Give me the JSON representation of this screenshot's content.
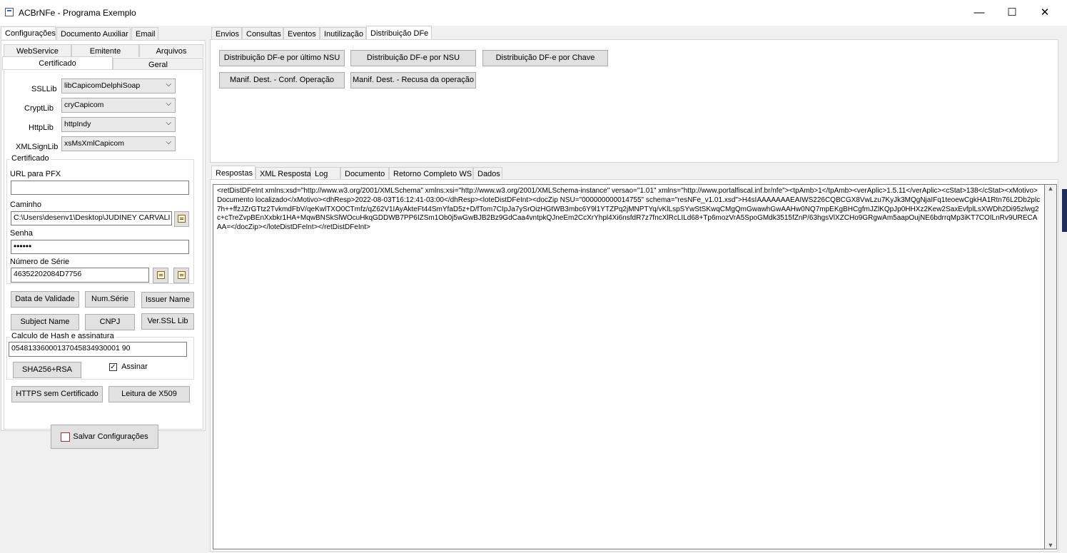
{
  "window": {
    "title": "ACBrNFe - Programa Exemplo",
    "minimize": "—",
    "maximize": "☐",
    "close": "✕"
  },
  "left": {
    "tabs": [
      "Configurações",
      "Documento Auxiliar",
      "Email"
    ],
    "subtabs_row1": [
      "WebService",
      "Emitente",
      "Arquivos"
    ],
    "subtabs_row2": [
      "Certificado",
      "Geral"
    ],
    "ssllib": {
      "label": "SSLLib",
      "value": "libCapicomDelphiSoap"
    },
    "cryptlib": {
      "label": "CryptLib",
      "value": "cryCapicom"
    },
    "httplib": {
      "label": "HttpLib",
      "value": "httpIndy"
    },
    "xmlsignlib": {
      "label": "XMLSignLib",
      "value": "xsMsXmlCapicom"
    },
    "certificado": {
      "group_title": "Certificado",
      "url_pfx_label": "URL para PFX",
      "url_pfx_value": "",
      "caminho_label": "Caminho",
      "caminho_value": "C:\\Users\\desenv1\\Desktop\\JUDINEY CARVALI",
      "senha_label": "Senha",
      "senha_value": "••••••",
      "numero_serie_label": "Número de Série",
      "numero_serie_value": "46352202084D7756"
    },
    "buttons": {
      "data_validade": "Data de Validade",
      "num_serie": "Num.Série",
      "issuer_name": "Issuer Name",
      "subject_name": "Subject Name",
      "cnpj": "CNPJ",
      "ver_ssl_lib": "Ver.SSL Lib"
    },
    "hash": {
      "group_title": "Calculo de Hash e assinatura",
      "value": "05481336000137045834930001 90",
      "sha_button": "SHA256+RSA",
      "assinar_label": "Assinar",
      "assinar_checked": "✓"
    },
    "https_button": "HTTPS sem Certificado",
    "x509_button": "Leitura de X509",
    "salvar_button": "Salvar Configurações"
  },
  "right": {
    "tabs": [
      "Envios",
      "Consultas",
      "Eventos",
      "Inutilização",
      "Distribuição DFe"
    ],
    "buttons": {
      "dist_ultimo_nsu": "Distribuição DF-e por último NSU",
      "dist_nsu": "Distribuição DF-e por NSU",
      "dist_chave": "Distribuição DF-e por Chave",
      "manif_conf": "Manif. Dest. - Conf. Operação",
      "manif_recusa": "Manif. Dest. - Recusa da operação"
    },
    "resp_tabs": [
      "Respostas",
      "XML Resposta",
      "Log",
      "Documento",
      "Retorno Completo WS",
      "Dados"
    ],
    "response_text": "<retDistDFeInt xmlns:xsd=\"http://www.w3.org/2001/XMLSchema\" xmlns:xsi=\"http://www.w3.org/2001/XMLSchema-instance\" versao=\"1.01\" xmlns=\"http://www.portalfiscal.inf.br/nfe\"><tpAmb>1</tpAmb><verAplic>1.5.11</verAplic><cStat>138</cStat><xMotivo>Documento localizado</xMotivo><dhResp>2022-08-03T16:12:41-03:00</dhResp><loteDistDFeInt><docZip NSU=\"000000000014755\" schema=\"resNFe_v1.01.xsd\">H4sIAAAAAAAEAIWS226CQBCGX8VwLzu7KyJk3MQgNjaIFq1teoewCgkHA1Rtn76L2Db2plc7h++ffzJZrGTtz2TvkmdFbV/qeKwlTXO0CTmfz/qZ62V1IAyAkteFt44SmYfaD5z+D/fTom7CIpJa7ySrOizHGtWB3mbc6Y9l1YTZPq2jMNPTYq/vKlLspSYwStSKwqCMgQmGwawhGwAAHw0NQ7mpEKgBHCgfmJZlKQpJp0HHXz2Kew2SaxEvfplLsXWDh2Di95zlwg2c+cTreZvpBEnXxbkr1HA+MqwBNSkSlWOcuHkqGDDWB7PP6IZSm1Ob0j5wGwBJB2Bz9GdCaa4vntpkQJneEm2CcXrYhpl4Xi6nsfdR7z7fncXlRcLILd68+Tp6mozVrA5SpoGMdk3515fZnP/63hgsVlXZCHo9GRgwAm5aapOujNE6bdrrqMp3iKT7COILnRv9URECAAA=</docZip></loteDistDFeInt></retDistDFeInt>"
  }
}
